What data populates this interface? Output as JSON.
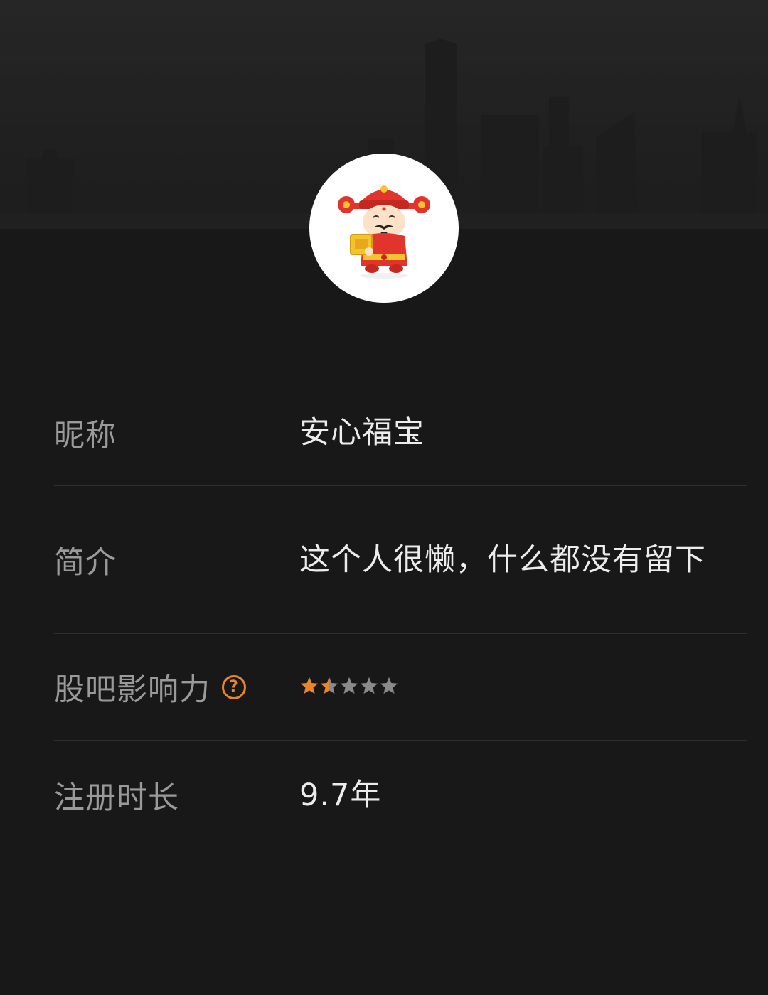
{
  "profile": {
    "avatar": "fortune-god-avatar"
  },
  "fields": {
    "nickname_label": "昵称",
    "nickname_value": "安心福宝",
    "bio_label": "简介",
    "bio_value": "这个人很懒，什么都没有留下",
    "influence_label": "股吧影响力",
    "influence_help": "?",
    "influence_rating": 1.5,
    "influence_max": 5,
    "reg_label": "注册时长",
    "reg_value": "9.7年"
  },
  "colors": {
    "background": "#181818",
    "label": "#9a9a9a",
    "value": "#ececec",
    "accent": "#e9862d",
    "star_off": "#8a8a8a"
  }
}
